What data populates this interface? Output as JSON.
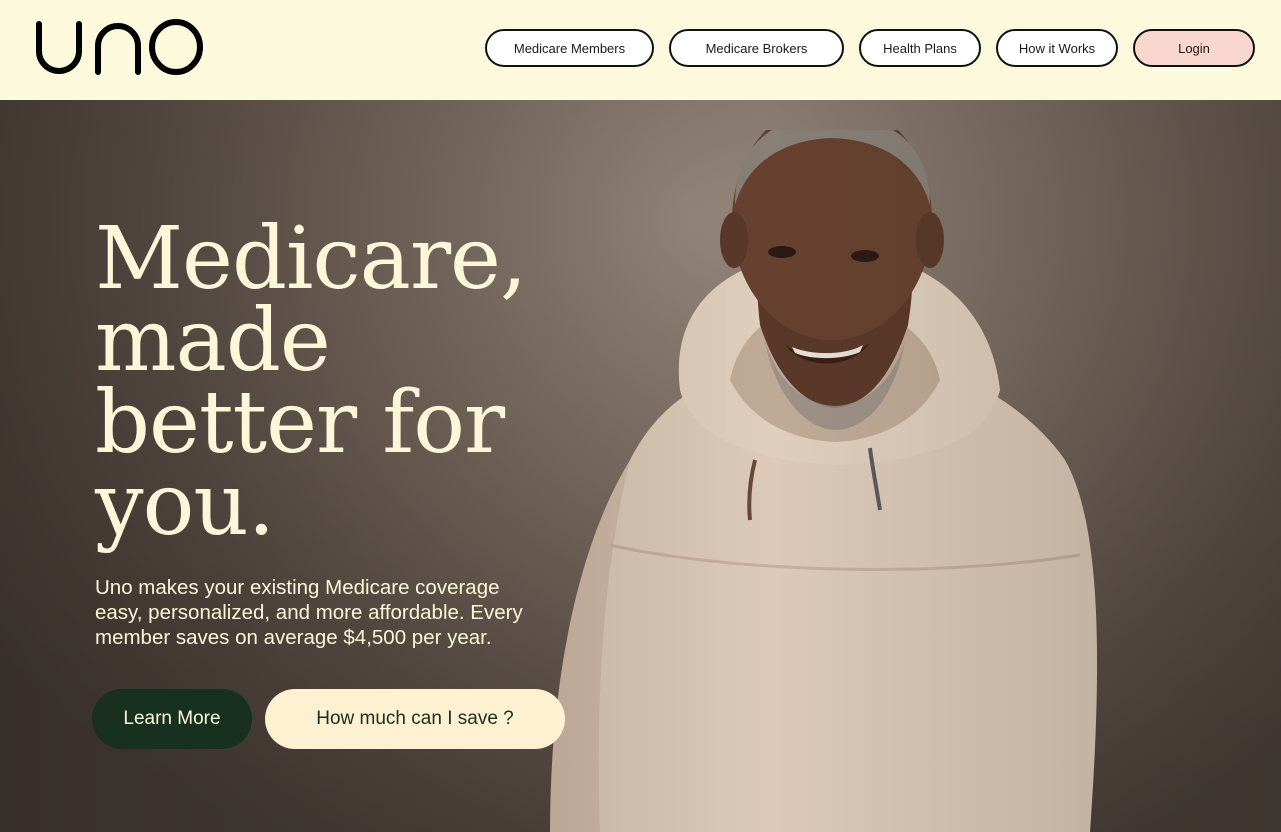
{
  "brand": {
    "logo_text": "uno",
    "header_bg": "#fdf9dc",
    "dark_green": "#17301f",
    "cream": "#fdf6d8",
    "login_bg": "#f9d6ce"
  },
  "nav": {
    "items": [
      {
        "label": "Medicare Members"
      },
      {
        "label": "Medicare Brokers"
      },
      {
        "label": "Health Plans"
      },
      {
        "label": "How it Works"
      },
      {
        "label": "Login"
      }
    ]
  },
  "hero": {
    "headline_lines": [
      "Medicare,",
      "made",
      "better for",
      "you."
    ],
    "subtext_lines": [
      "Uno makes your existing Medicare coverage",
      "easy, personalized, and more affordable. Every",
      "member saves on average $4,500 per year."
    ],
    "primary_cta": "Learn More",
    "secondary_cta": "How much can I save ?",
    "image": "smiling-senior-man-in-cream-hoodie-photo"
  }
}
